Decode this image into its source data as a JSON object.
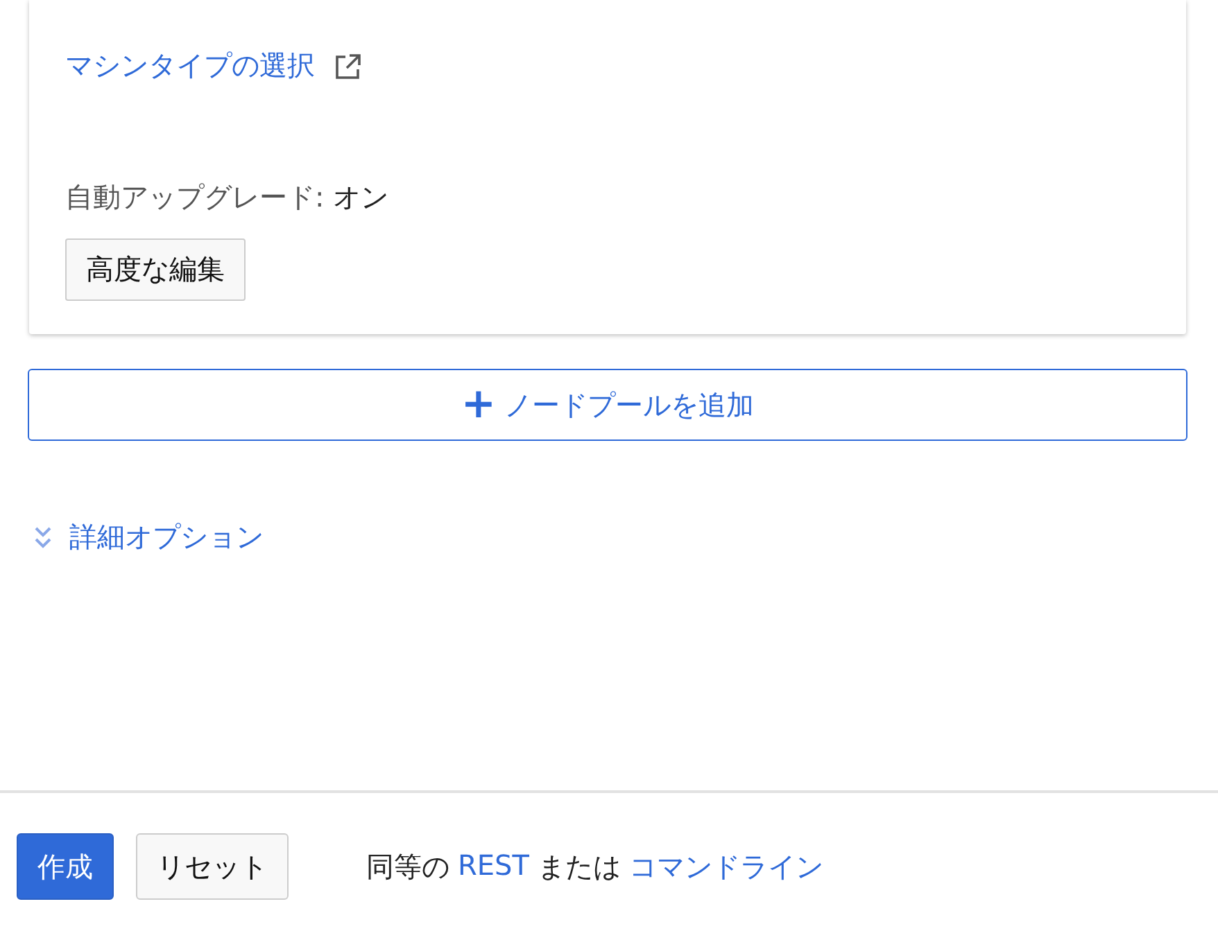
{
  "node_pool_card": {
    "machine_type_link": "マシンタイプの選択",
    "auto_upgrade": {
      "label": "自動アップグレード:",
      "value": "オン"
    },
    "edit_button": "高度な編集"
  },
  "add_node_pool_button": {
    "icon": "+",
    "label": "ノードプールを追加"
  },
  "advanced_options": {
    "label": "詳細オプション",
    "expanded": false
  },
  "footer": {
    "buttons": [
      {
        "label": "作成",
        "kind": "primary"
      },
      {
        "label": "リセット",
        "kind": "secondary"
      }
    ],
    "equivalent": {
      "prefix": "同等の",
      "rest_link": "REST",
      "middle": "または",
      "command_link": "コマンドライン"
    }
  }
}
